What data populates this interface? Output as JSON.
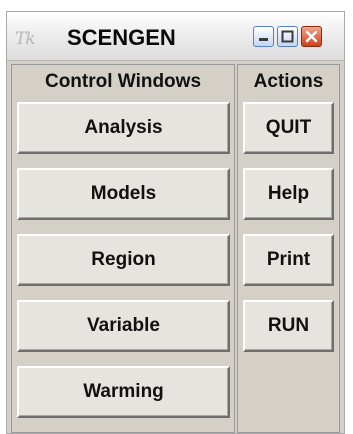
{
  "window": {
    "icon_text": "Tk",
    "title": "SCENGEN"
  },
  "title_controls": [
    {
      "name": "minimize-icon"
    },
    {
      "name": "maximize-icon"
    },
    {
      "name": "close-icon"
    }
  ],
  "control_windows": {
    "header": "Control Windows",
    "buttons": [
      "Analysis",
      "Models",
      "Region",
      "Variable",
      "Warming"
    ]
  },
  "actions": {
    "header": "Actions",
    "buttons": [
      "QUIT",
      "Help",
      "Print",
      "RUN"
    ]
  },
  "colors": {
    "window_bg": "#d4d0c8",
    "button_bg": "#e6e4de",
    "close_button": "#d2401a",
    "title_button_border": "#5a7fc4"
  }
}
